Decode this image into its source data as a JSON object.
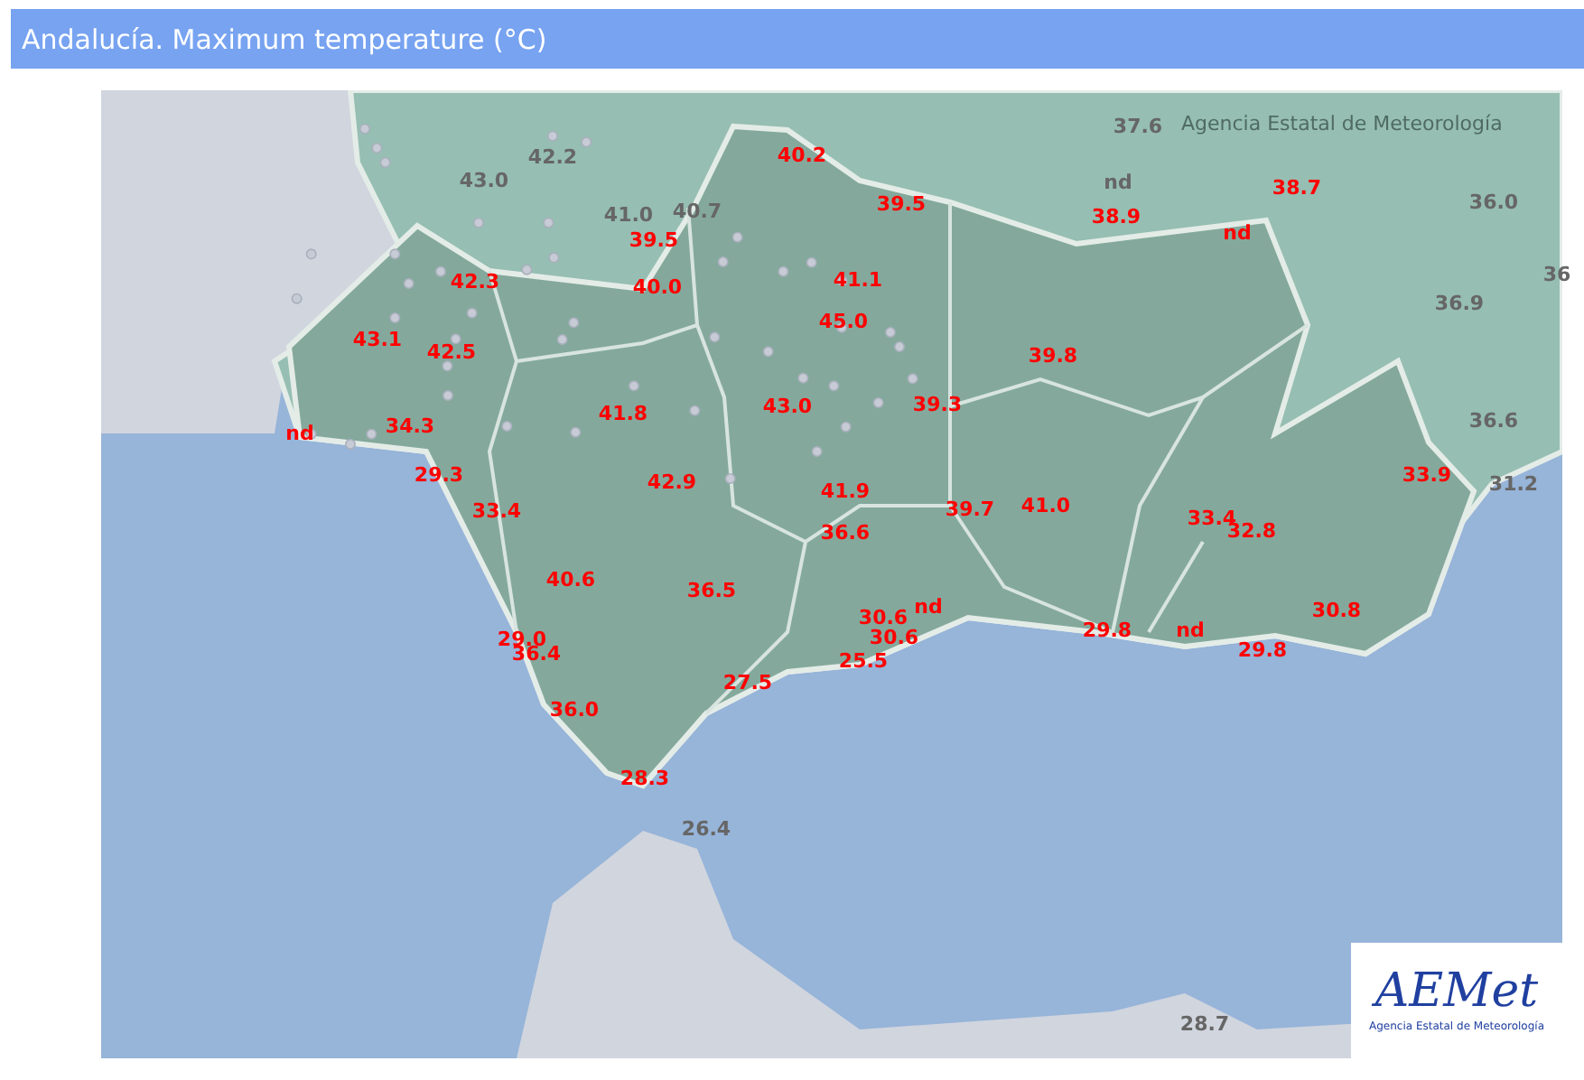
{
  "header": {
    "title": "Andalucía. Maximum temperature (°C)"
  },
  "map": {
    "attribution": "Agencia Estatal de Meteorología",
    "readings": [
      {
        "kind": "outside",
        "value": "43.0"
      },
      {
        "kind": "outside",
        "value": "42.2"
      },
      {
        "kind": "outside",
        "value": "41.0"
      },
      {
        "kind": "outside",
        "value": "40.7"
      },
      {
        "kind": "outside",
        "value": "37.6"
      },
      {
        "kind": "outside",
        "value": "nd"
      },
      {
        "kind": "outside",
        "value": "36.0"
      },
      {
        "kind": "outside",
        "value": "36"
      },
      {
        "kind": "outside",
        "value": "36.9"
      },
      {
        "kind": "outside",
        "value": "36.6"
      },
      {
        "kind": "outside",
        "value": "31.2"
      },
      {
        "kind": "outside",
        "value": "26.4"
      },
      {
        "kind": "outside",
        "value": "28.7"
      },
      {
        "kind": "inside",
        "value": "40.2"
      },
      {
        "kind": "inside",
        "value": "39.5"
      },
      {
        "kind": "inside",
        "value": "39.5"
      },
      {
        "kind": "inside",
        "value": "42.3"
      },
      {
        "kind": "inside",
        "value": "40.0"
      },
      {
        "kind": "inside",
        "value": "41.1"
      },
      {
        "kind": "inside",
        "value": "45.0"
      },
      {
        "kind": "inside",
        "value": "43.1"
      },
      {
        "kind": "inside",
        "value": "42.5"
      },
      {
        "kind": "inside",
        "value": "38.9"
      },
      {
        "kind": "inside",
        "value": "38.7"
      },
      {
        "kind": "inside",
        "value": "nd"
      },
      {
        "kind": "inside",
        "value": "39.8"
      },
      {
        "kind": "inside",
        "value": "nd"
      },
      {
        "kind": "inside",
        "value": "34.3"
      },
      {
        "kind": "inside",
        "value": "41.8"
      },
      {
        "kind": "inside",
        "value": "43.0"
      },
      {
        "kind": "inside",
        "value": "39.3"
      },
      {
        "kind": "inside",
        "value": "29.3"
      },
      {
        "kind": "inside",
        "value": "42.9"
      },
      {
        "kind": "inside",
        "value": "41.9"
      },
      {
        "kind": "inside",
        "value": "33.9"
      },
      {
        "kind": "inside",
        "value": "33.4"
      },
      {
        "kind": "inside",
        "value": "39.7"
      },
      {
        "kind": "inside",
        "value": "41.0"
      },
      {
        "kind": "inside",
        "value": "36.6"
      },
      {
        "kind": "inside",
        "value": "33.4"
      },
      {
        "kind": "inside",
        "value": "32.8"
      },
      {
        "kind": "inside",
        "value": "40.6"
      },
      {
        "kind": "inside",
        "value": "36.5"
      },
      {
        "kind": "inside",
        "value": "30.6"
      },
      {
        "kind": "inside",
        "value": "nd"
      },
      {
        "kind": "inside",
        "value": "29.0"
      },
      {
        "kind": "inside",
        "value": "36.4"
      },
      {
        "kind": "inside",
        "value": "30.6"
      },
      {
        "kind": "inside",
        "value": "29.8"
      },
      {
        "kind": "inside",
        "value": "nd"
      },
      {
        "kind": "inside",
        "value": "30.8"
      },
      {
        "kind": "inside",
        "value": "29.8"
      },
      {
        "kind": "inside",
        "value": "25.5"
      },
      {
        "kind": "inside",
        "value": "27.5"
      },
      {
        "kind": "inside",
        "value": "36.0"
      },
      {
        "kind": "inside",
        "value": "28.3"
      }
    ]
  },
  "logo": {
    "wordmark": "AEMet",
    "caption": "Agencia Estatal de Meteorología"
  }
}
